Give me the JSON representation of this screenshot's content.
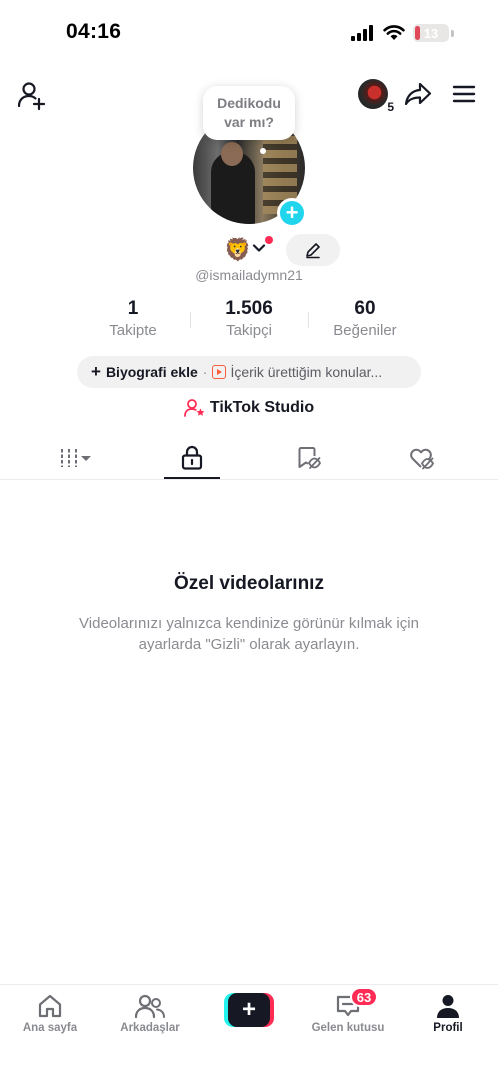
{
  "status_bar": {
    "time": "04:16",
    "battery": "13"
  },
  "header": {
    "story_count": "5"
  },
  "profile": {
    "bubble_text": "Dedikodu var mı?",
    "emoji": "🦁",
    "username": "@ismailadymn21"
  },
  "stats": [
    {
      "value": "1",
      "label": "Takipte"
    },
    {
      "value": "1.506",
      "label": "Takipçi"
    },
    {
      "value": "60",
      "label": "Beğeniler"
    }
  ],
  "bio": {
    "add_label": "Biyografi ekle",
    "separator": "·",
    "topics_label": "İçerik ürettiğim konular..."
  },
  "studio": {
    "label": "TikTok Studio"
  },
  "tabs": [
    {
      "icon": "videos-grid-icon"
    },
    {
      "icon": "lock-icon",
      "active": true
    },
    {
      "icon": "reposts-hidden-icon"
    },
    {
      "icon": "liked-hidden-icon"
    }
  ],
  "empty_state": {
    "title": "Özel videolarınız",
    "description": "Videolarınızı yalnızca kendinize görünür kılmak için ayarlarda \"Gizli\" olarak ayarlayın."
  },
  "bottom_nav": {
    "home": "Ana sayfa",
    "friends": "Arkadaşlar",
    "create": "+",
    "inbox": "Gelen kutusu",
    "inbox_badge": "63",
    "profile": "Profil"
  },
  "colors": {
    "accent": "#fe2c55",
    "cyan": "#20d5ec",
    "text": "#161823",
    "muted": "#8a8b91"
  }
}
